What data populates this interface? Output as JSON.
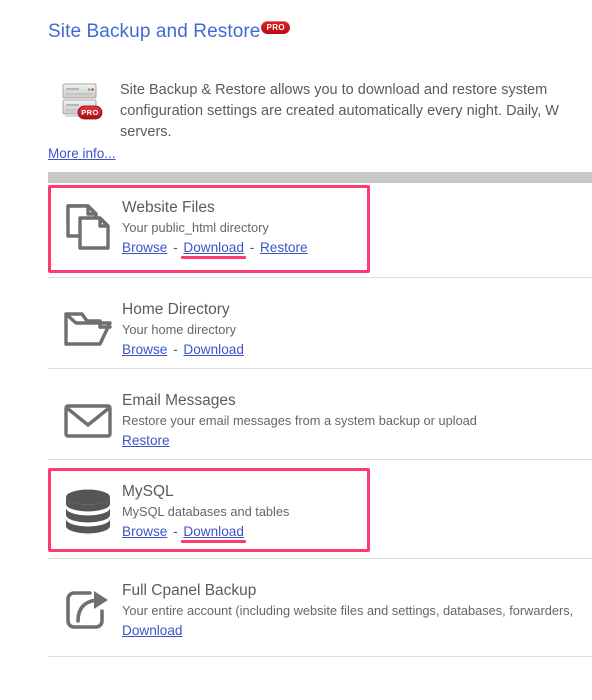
{
  "header": {
    "title": "Site Backup and Restore",
    "badge": "PRO",
    "badge_color": "#cf1020",
    "title_color": "#4169d6"
  },
  "intro": {
    "icon": "server-rack-icon",
    "badge": "PRO",
    "text": "Site Backup & Restore allows you to download and restore system configuration settings are created automatically every night. Daily, W servers.",
    "more_info_label": "More info..."
  },
  "annotations": {
    "color": "#fb3b6e",
    "boxes": [
      "website-files-row",
      "mysql-row"
    ],
    "underlined_links": [
      "website-files-download",
      "mysql-download"
    ]
  },
  "sections": [
    {
      "id": "website-files",
      "icon": "copy-files-icon",
      "title": "Website Files",
      "description": "Your public_html directory",
      "links": [
        {
          "label": "Browse",
          "highlighted": false
        },
        {
          "label": "Download",
          "highlighted": true
        },
        {
          "label": "Restore",
          "highlighted": false
        }
      ],
      "separator": " - "
    },
    {
      "id": "home-directory",
      "icon": "folder-icon",
      "title": "Home Directory",
      "description": "Your home directory",
      "links": [
        {
          "label": "Browse",
          "highlighted": false
        },
        {
          "label": "Download",
          "highlighted": false
        }
      ],
      "separator": " - "
    },
    {
      "id": "email-messages",
      "icon": "envelope-icon",
      "title": "Email Messages",
      "description": "Restore your email messages from a system backup or upload",
      "links": [
        {
          "label": "Restore",
          "highlighted": false
        }
      ],
      "separator": " - "
    },
    {
      "id": "mysql",
      "icon": "database-icon",
      "title": "MySQL",
      "description": "MySQL databases and tables",
      "links": [
        {
          "label": "Browse",
          "highlighted": false
        },
        {
          "label": "Download",
          "highlighted": true
        }
      ],
      "separator": " - "
    },
    {
      "id": "full-cpanel-backup",
      "icon": "share-arrow-icon",
      "title": "Full Cpanel Backup",
      "description": "Your entire account (including website files and settings, databases, forwarders,",
      "links": [
        {
          "label": "Download",
          "highlighted": false
        }
      ],
      "separator": " - "
    }
  ]
}
